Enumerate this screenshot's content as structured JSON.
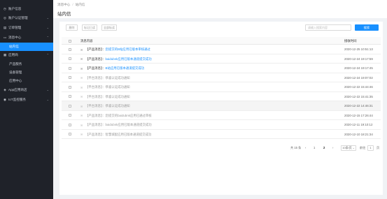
{
  "sidebar": {
    "items": [
      {
        "icon": "user-icon",
        "glyph": "◷",
        "label": "账户信息",
        "chevron": ""
      },
      {
        "icon": "user-check-icon",
        "glyph": "◎",
        "label": "账户认证管理",
        "chevron": "⌄"
      },
      {
        "icon": "order-icon",
        "glyph": "▤",
        "label": "订单管理",
        "chevron": "⌄"
      },
      {
        "icon": "message-icon",
        "glyph": "▭",
        "label": "消息中心",
        "chevron": "⌃"
      },
      {
        "label": "站内信",
        "sub": true,
        "active": true
      },
      {
        "icon": "apps-icon",
        "glyph": "▦",
        "label": "应用商",
        "chevron": "⌃"
      },
      {
        "label": "产品服务",
        "sub": true
      },
      {
        "label": "设备管理",
        "sub": true
      },
      {
        "label": "应用中心",
        "sub": true
      },
      {
        "icon": "app-store-icon",
        "glyph": "◈",
        "label": "App应用商店",
        "chevron": "⌄"
      },
      {
        "icon": "iot-monitor-icon",
        "glyph": "◉",
        "label": "IoT监控服务",
        "chevron": "⌄"
      }
    ]
  },
  "header": {
    "breadcrumb": [
      "消息中心",
      "站内信"
    ],
    "title": "站内信"
  },
  "toolbar": {
    "delete_label": "删除",
    "mark_read_label": "标记已读",
    "mark_all_read_label": "全部标读",
    "search_placeholder": "请输入搜索内容",
    "search_label": "搜索"
  },
  "table": {
    "col_content": "消息内容",
    "col_time": "接收时间",
    "rows": [
      {
        "prefix": "【产品消息】：",
        "text": "您提交的B站应用已版本审核通过",
        "time": "2020-12-25 10:51:13",
        "unread": true
      },
      {
        "prefix": "【产品消息】：",
        "text": "baidubnk应用已版本通道提交成功",
        "time": "2020-12-24 19:17:59",
        "unread": true
      },
      {
        "prefix": "【产品消息】：",
        "text": "B站应用已版本通道提交成功",
        "time": "2020-12-24 19:17:45",
        "unread": true
      },
      {
        "prefix": "【平台消息】：",
        "text": "恭喜认证成功通知",
        "time": "2020-12-24 19:07:02",
        "unread": false
      },
      {
        "prefix": "【平台消息】：",
        "text": "恭喜认证成功通知",
        "time": "2020-12-22 15:44:46",
        "unread": false
      },
      {
        "prefix": "【平台消息】：",
        "text": "恭喜认证成功通知",
        "time": "2020-12-22 15:41:35",
        "unread": false
      },
      {
        "prefix": "【平台消息】：",
        "text": "恭喜认证成功通知",
        "time": "2020-12-22 14:46:31",
        "unread": false
      },
      {
        "prefix": "【产品消息】：",
        "text": "您提交的baidubnk应用已通过审核",
        "time": "2020-12-15 17:26:44",
        "unread": false
      },
      {
        "prefix": "【产品消息】：",
        "text": "baidubnk应用已版本通道提交成功",
        "time": "2020-12-11 19:10:12",
        "unread": false
      },
      {
        "prefix": "【产品消息】：",
        "text": "智慧城配应用已版本通道提交成功",
        "time": "2020-12-10 18:21:34",
        "unread": false
      }
    ]
  },
  "pagination": {
    "total": "共 15 条",
    "prev": "‹",
    "pages": [
      "1",
      "2"
    ],
    "current": "2",
    "next": "›",
    "page_size": "10条/页",
    "goto_label": "前往",
    "goto_value": "1",
    "goto_suffix": "页"
  },
  "colors": {
    "accent": "#1890ff",
    "sidebar_bg": "#1f2229"
  }
}
